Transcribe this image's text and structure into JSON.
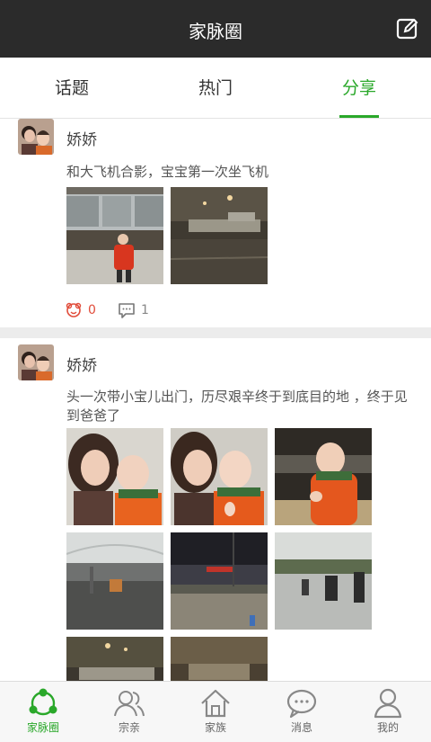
{
  "header": {
    "title": "家脉圈",
    "compose_icon": "compose-icon",
    "background": "#2b2b2b"
  },
  "tabs": [
    {
      "label": "话题",
      "active": false
    },
    {
      "label": "热门",
      "active": false
    },
    {
      "label": "分享",
      "active": true
    }
  ],
  "accent_color": "#2aa82a",
  "posts": [
    {
      "author": "娇娇",
      "text": "和大飞机合影，宝宝第一次坐飞机",
      "photo_count": 2,
      "likes": "0",
      "comments": "1"
    },
    {
      "author": "娇娇",
      "text": "头一次带小宝儿出门，历尽艰辛终于到底目的地 ，终于见到爸爸了",
      "photo_count": 8
    }
  ],
  "bottom_nav": [
    {
      "label": "家脉圈",
      "icon": "family-circle-icon",
      "active": true
    },
    {
      "label": "宗亲",
      "icon": "relatives-icon",
      "active": false
    },
    {
      "label": "家族",
      "icon": "home-icon",
      "active": false
    },
    {
      "label": "消息",
      "icon": "message-icon",
      "active": false
    },
    {
      "label": "我的",
      "icon": "profile-icon",
      "active": false
    }
  ]
}
